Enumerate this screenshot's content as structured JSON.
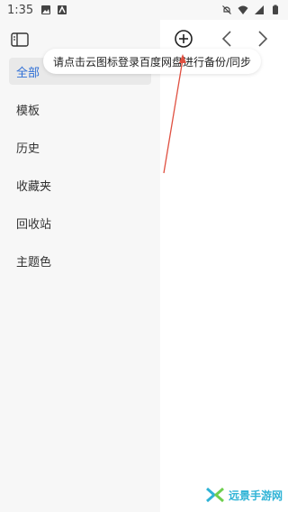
{
  "status_bar": {
    "time": "1:35"
  },
  "sidebar": {
    "items": [
      {
        "label": "全部",
        "active": true
      },
      {
        "label": "模板",
        "active": false
      },
      {
        "label": "历史",
        "active": false
      },
      {
        "label": "收藏夹",
        "active": false
      },
      {
        "label": "回收站",
        "active": false
      },
      {
        "label": "主题色",
        "active": false
      }
    ]
  },
  "tooltip": {
    "text": "请点击云图标登录百度网盘进行备份/同步"
  },
  "colors": {
    "accent": "#2f6fd6",
    "arrow": "#e05040",
    "watermark": "#2fb3d6"
  },
  "watermark": {
    "text": "远景手游网"
  }
}
